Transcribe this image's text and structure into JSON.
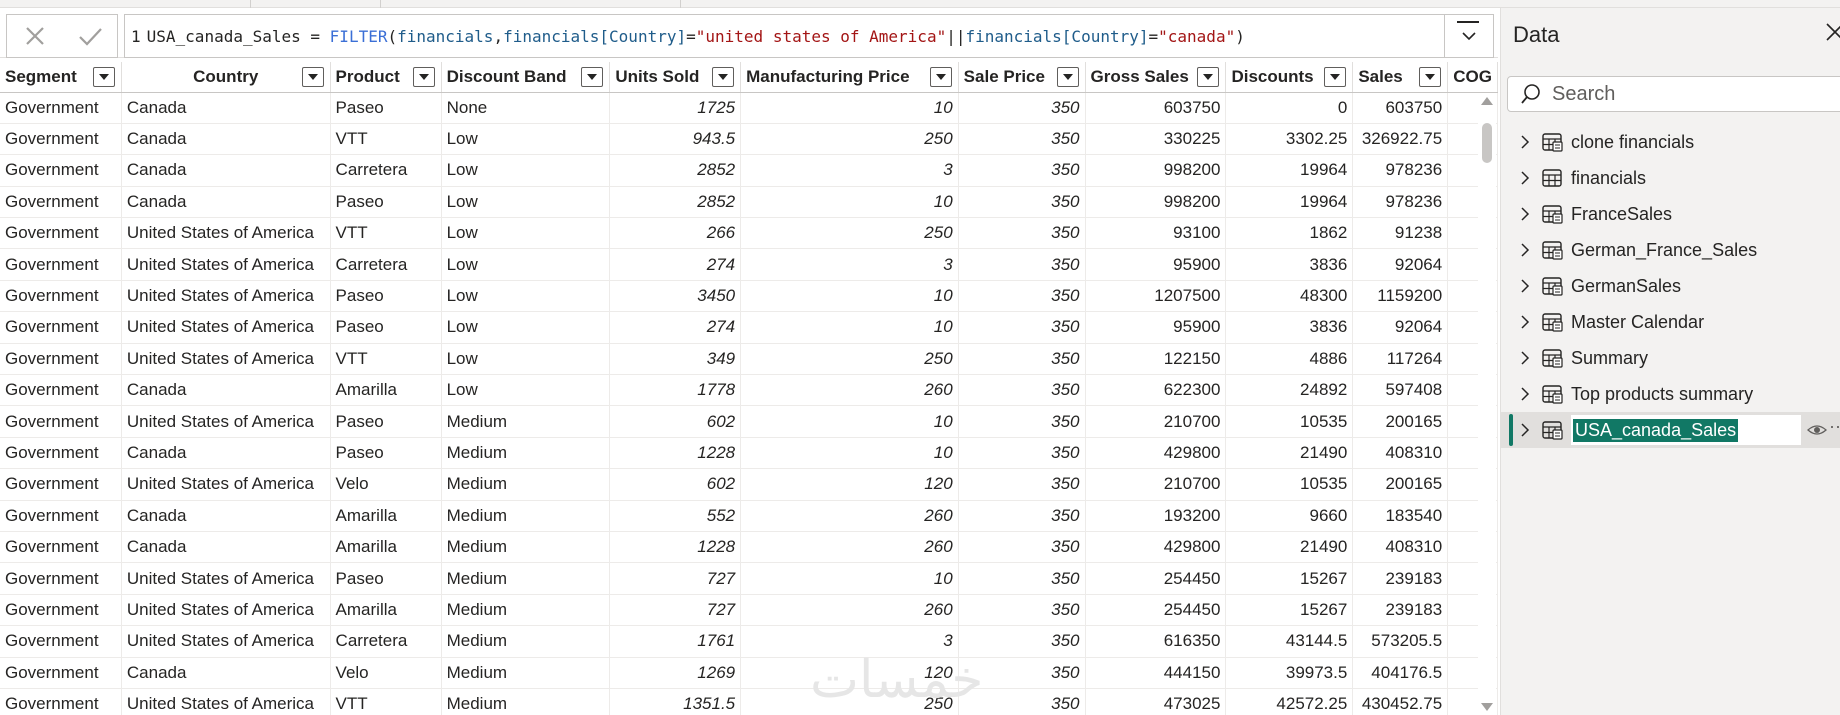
{
  "formula": {
    "line_number": "1",
    "table_name": "USA_canada_Sales",
    "equals": " = ",
    "function": "FILTER",
    "open_paren": "(",
    "arg_table": "financials",
    "comma": ",",
    "ref1_table": "financials",
    "ref1_column": "[Country]",
    "eq1": "=",
    "value1": "\"united states of America\"",
    "or_op": "||",
    "ref2_table": "financials",
    "ref2_column": "[Country]",
    "eq2": "=",
    "value2": "\"canada\"",
    "close_paren": ")"
  },
  "colors": {
    "accent": "#117865",
    "function": "#3b6fd6",
    "string": "#a31515"
  },
  "icons": {
    "cancel": "close-x-icon",
    "commit": "check-icon",
    "expand": "chevron-down-icon",
    "search": "search-icon",
    "table": "table-icon",
    "calculated_table": "calculated-table-icon"
  },
  "grid": {
    "columns": [
      "Segment",
      "Country",
      "Product",
      "Discount Band",
      "Units Sold",
      "Manufacturing Price",
      "Sale Price",
      "Gross Sales",
      "Discounts",
      "Sales",
      "COG"
    ],
    "rows": [
      [
        "Government",
        "Canada",
        "Paseo",
        "None",
        "1725",
        "10",
        "350",
        "603750",
        "0",
        "603750"
      ],
      [
        "Government",
        "Canada",
        "VTT",
        "Low",
        "943.5",
        "250",
        "350",
        "330225",
        "3302.25",
        "326922.75"
      ],
      [
        "Government",
        "Canada",
        "Carretera",
        "Low",
        "2852",
        "3",
        "350",
        "998200",
        "19964",
        "978236"
      ],
      [
        "Government",
        "Canada",
        "Paseo",
        "Low",
        "2852",
        "10",
        "350",
        "998200",
        "19964",
        "978236"
      ],
      [
        "Government",
        "United States of America",
        "VTT",
        "Low",
        "266",
        "250",
        "350",
        "93100",
        "1862",
        "91238"
      ],
      [
        "Government",
        "United States of America",
        "Carretera",
        "Low",
        "274",
        "3",
        "350",
        "95900",
        "3836",
        "92064"
      ],
      [
        "Government",
        "United States of America",
        "Paseo",
        "Low",
        "3450",
        "10",
        "350",
        "1207500",
        "48300",
        "1159200"
      ],
      [
        "Government",
        "United States of America",
        "Paseo",
        "Low",
        "274",
        "10",
        "350",
        "95900",
        "3836",
        "92064"
      ],
      [
        "Government",
        "United States of America",
        "VTT",
        "Low",
        "349",
        "250",
        "350",
        "122150",
        "4886",
        "117264"
      ],
      [
        "Government",
        "Canada",
        "Amarilla",
        "Low",
        "1778",
        "260",
        "350",
        "622300",
        "24892",
        "597408"
      ],
      [
        "Government",
        "United States of America",
        "Paseo",
        "Medium",
        "602",
        "10",
        "350",
        "210700",
        "10535",
        "200165"
      ],
      [
        "Government",
        "Canada",
        "Paseo",
        "Medium",
        "1228",
        "10",
        "350",
        "429800",
        "21490",
        "408310"
      ],
      [
        "Government",
        "United States of America",
        "Velo",
        "Medium",
        "602",
        "120",
        "350",
        "210700",
        "10535",
        "200165"
      ],
      [
        "Government",
        "Canada",
        "Amarilla",
        "Medium",
        "552",
        "260",
        "350",
        "193200",
        "9660",
        "183540"
      ],
      [
        "Government",
        "Canada",
        "Amarilla",
        "Medium",
        "1228",
        "260",
        "350",
        "429800",
        "21490",
        "408310"
      ],
      [
        "Government",
        "United States of America",
        "Paseo",
        "Medium",
        "727",
        "10",
        "350",
        "254450",
        "15267",
        "239183"
      ],
      [
        "Government",
        "United States of America",
        "Amarilla",
        "Medium",
        "727",
        "260",
        "350",
        "254450",
        "15267",
        "239183"
      ],
      [
        "Government",
        "United States of America",
        "Carretera",
        "Medium",
        "1761",
        "3",
        "350",
        "616350",
        "43144.5",
        "573205.5"
      ],
      [
        "Government",
        "Canada",
        "Velo",
        "Medium",
        "1269",
        "120",
        "350",
        "444150",
        "39973.5",
        "404176.5"
      ],
      [
        "Government",
        "United States of America",
        "VTT",
        "Medium",
        "1351.5",
        "250",
        "350",
        "473025",
        "42572.25",
        "430452.75"
      ]
    ]
  },
  "data_panel": {
    "title": "Data",
    "search_placeholder": "Search",
    "tables": [
      {
        "label": "clone financials",
        "icon": "calculated-table-icon"
      },
      {
        "label": "financials",
        "icon": "table-icon"
      },
      {
        "label": "FranceSales",
        "icon": "calculated-table-icon"
      },
      {
        "label": "German_France_Sales",
        "icon": "calculated-table-icon"
      },
      {
        "label": "GermanSales",
        "icon": "calculated-table-icon"
      },
      {
        "label": "Master Calendar",
        "icon": "calculated-table-icon"
      },
      {
        "label": "Summary",
        "icon": "calculated-table-icon"
      },
      {
        "label": "Top products summary",
        "icon": "calculated-table-icon"
      },
      {
        "label": "USA_canada_Sales",
        "icon": "calculated-table-icon",
        "selected": true
      }
    ]
  },
  "watermark": "خمسات"
}
